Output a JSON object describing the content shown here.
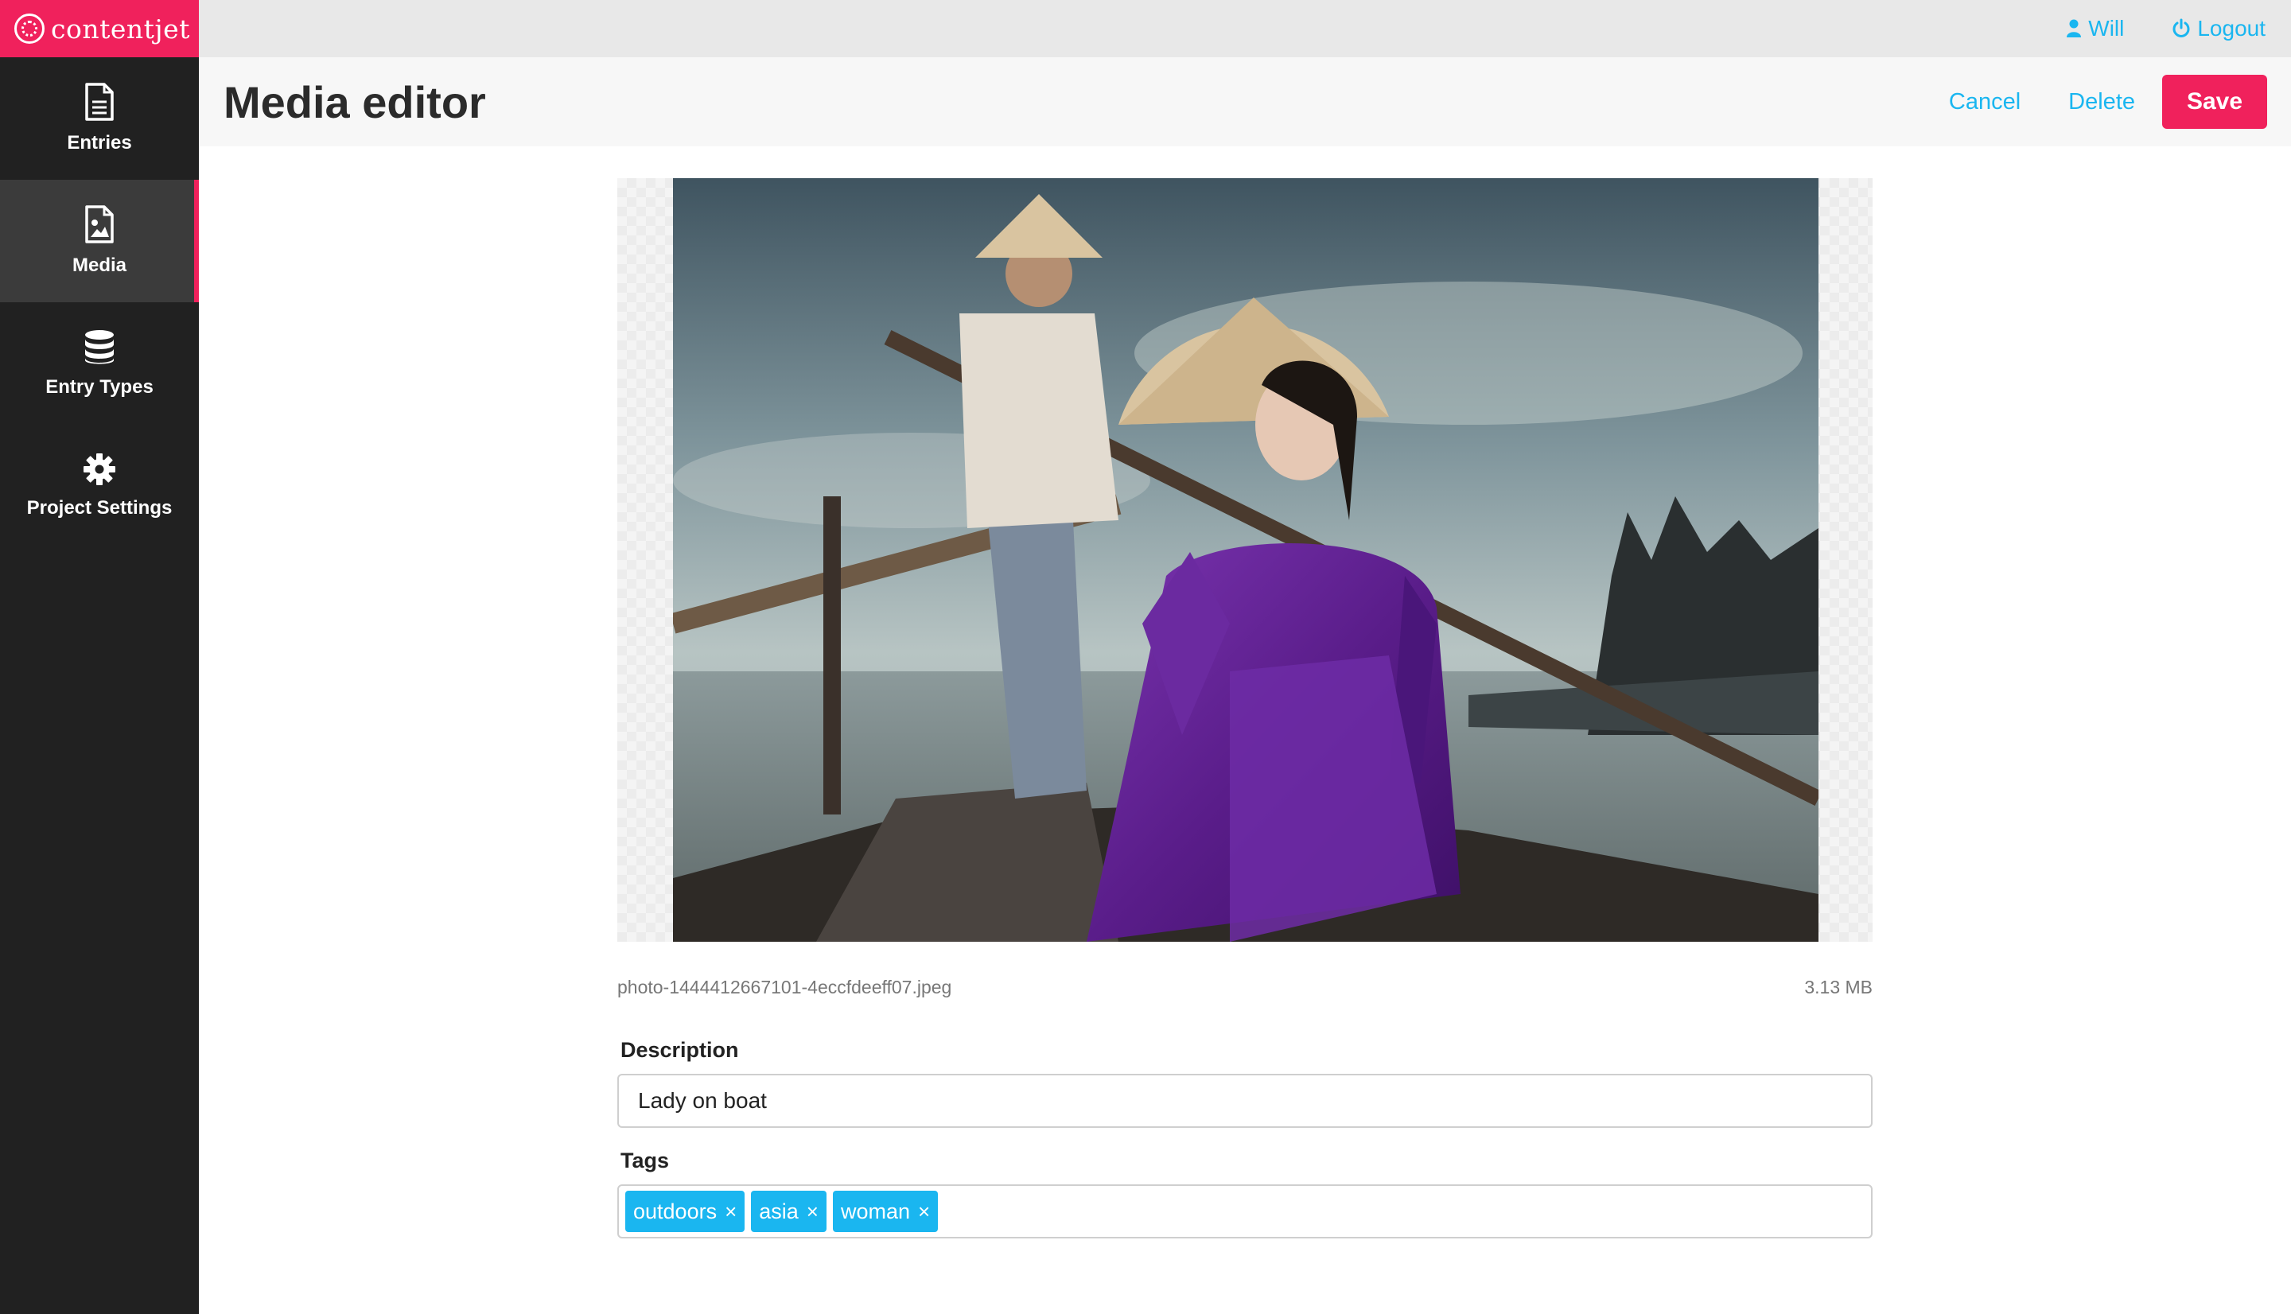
{
  "brand": {
    "name": "contentjet",
    "color": "#f0215c"
  },
  "sidebar": {
    "items": [
      {
        "label": "Entries",
        "icon": "document-icon",
        "active": false
      },
      {
        "label": "Media",
        "icon": "image-file-icon",
        "active": true
      },
      {
        "label": "Entry Types",
        "icon": "database-icon",
        "active": false
      },
      {
        "label": "Project Settings",
        "icon": "gear-icon",
        "active": false
      }
    ]
  },
  "topbar": {
    "user": {
      "label": "Will",
      "icon": "user-icon"
    },
    "logout": {
      "label": "Logout",
      "icon": "power-icon"
    },
    "accent": "#1ab6f0"
  },
  "header": {
    "title": "Media editor",
    "cancel_label": "Cancel",
    "delete_label": "Delete",
    "save_label": "Save"
  },
  "media": {
    "filename": "photo-1444412667101-4eccfdeeff07.jpeg",
    "size": "3.13 MB",
    "image_subject": "woman-in-purple-dress-on-boat"
  },
  "form": {
    "description_label": "Description",
    "description_value": "Lady on boat",
    "tags_label": "Tags",
    "tags": [
      "outdoors",
      "asia",
      "woman"
    ],
    "tag_remove_glyph": "×"
  }
}
